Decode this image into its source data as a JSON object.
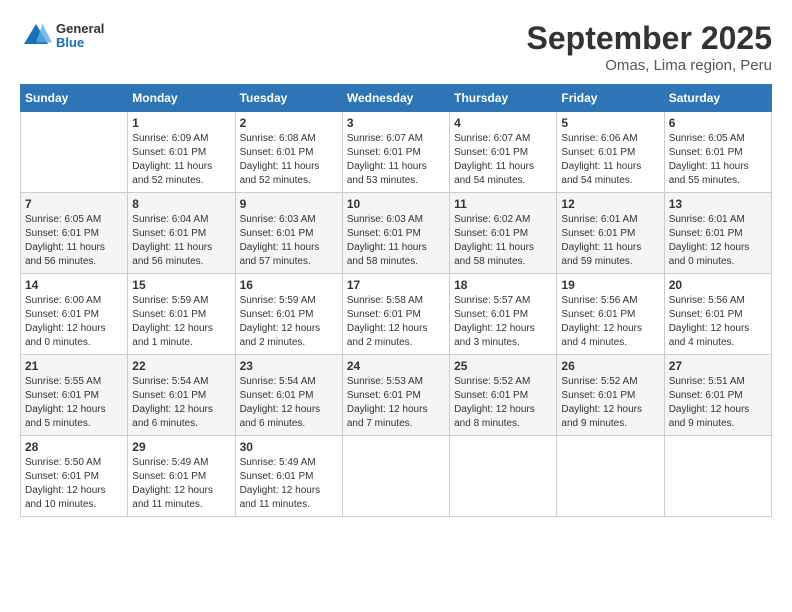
{
  "header": {
    "logo": {
      "general": "General",
      "blue": "Blue"
    },
    "title": "September 2025",
    "location": "Omas, Lima region, Peru"
  },
  "calendar": {
    "days_of_week": [
      "Sunday",
      "Monday",
      "Tuesday",
      "Wednesday",
      "Thursday",
      "Friday",
      "Saturday"
    ],
    "weeks": [
      [
        {
          "day": "",
          "sunrise": "",
          "sunset": "",
          "daylight": ""
        },
        {
          "day": "1",
          "sunrise": "Sunrise: 6:09 AM",
          "sunset": "Sunset: 6:01 PM",
          "daylight": "Daylight: 11 hours and 52 minutes."
        },
        {
          "day": "2",
          "sunrise": "Sunrise: 6:08 AM",
          "sunset": "Sunset: 6:01 PM",
          "daylight": "Daylight: 11 hours and 52 minutes."
        },
        {
          "day": "3",
          "sunrise": "Sunrise: 6:07 AM",
          "sunset": "Sunset: 6:01 PM",
          "daylight": "Daylight: 11 hours and 53 minutes."
        },
        {
          "day": "4",
          "sunrise": "Sunrise: 6:07 AM",
          "sunset": "Sunset: 6:01 PM",
          "daylight": "Daylight: 11 hours and 54 minutes."
        },
        {
          "day": "5",
          "sunrise": "Sunrise: 6:06 AM",
          "sunset": "Sunset: 6:01 PM",
          "daylight": "Daylight: 11 hours and 54 minutes."
        },
        {
          "day": "6",
          "sunrise": "Sunrise: 6:05 AM",
          "sunset": "Sunset: 6:01 PM",
          "daylight": "Daylight: 11 hours and 55 minutes."
        }
      ],
      [
        {
          "day": "7",
          "sunrise": "Sunrise: 6:05 AM",
          "sunset": "Sunset: 6:01 PM",
          "daylight": "Daylight: 11 hours and 56 minutes."
        },
        {
          "day": "8",
          "sunrise": "Sunrise: 6:04 AM",
          "sunset": "Sunset: 6:01 PM",
          "daylight": "Daylight: 11 hours and 56 minutes."
        },
        {
          "day": "9",
          "sunrise": "Sunrise: 6:03 AM",
          "sunset": "Sunset: 6:01 PM",
          "daylight": "Daylight: 11 hours and 57 minutes."
        },
        {
          "day": "10",
          "sunrise": "Sunrise: 6:03 AM",
          "sunset": "Sunset: 6:01 PM",
          "daylight": "Daylight: 11 hours and 58 minutes."
        },
        {
          "day": "11",
          "sunrise": "Sunrise: 6:02 AM",
          "sunset": "Sunset: 6:01 PM",
          "daylight": "Daylight: 11 hours and 58 minutes."
        },
        {
          "day": "12",
          "sunrise": "Sunrise: 6:01 AM",
          "sunset": "Sunset: 6:01 PM",
          "daylight": "Daylight: 11 hours and 59 minutes."
        },
        {
          "day": "13",
          "sunrise": "Sunrise: 6:01 AM",
          "sunset": "Sunset: 6:01 PM",
          "daylight": "Daylight: 12 hours and 0 minutes."
        }
      ],
      [
        {
          "day": "14",
          "sunrise": "Sunrise: 6:00 AM",
          "sunset": "Sunset: 6:01 PM",
          "daylight": "Daylight: 12 hours and 0 minutes."
        },
        {
          "day": "15",
          "sunrise": "Sunrise: 5:59 AM",
          "sunset": "Sunset: 6:01 PM",
          "daylight": "Daylight: 12 hours and 1 minute."
        },
        {
          "day": "16",
          "sunrise": "Sunrise: 5:59 AM",
          "sunset": "Sunset: 6:01 PM",
          "daylight": "Daylight: 12 hours and 2 minutes."
        },
        {
          "day": "17",
          "sunrise": "Sunrise: 5:58 AM",
          "sunset": "Sunset: 6:01 PM",
          "daylight": "Daylight: 12 hours and 2 minutes."
        },
        {
          "day": "18",
          "sunrise": "Sunrise: 5:57 AM",
          "sunset": "Sunset: 6:01 PM",
          "daylight": "Daylight: 12 hours and 3 minutes."
        },
        {
          "day": "19",
          "sunrise": "Sunrise: 5:56 AM",
          "sunset": "Sunset: 6:01 PM",
          "daylight": "Daylight: 12 hours and 4 minutes."
        },
        {
          "day": "20",
          "sunrise": "Sunrise: 5:56 AM",
          "sunset": "Sunset: 6:01 PM",
          "daylight": "Daylight: 12 hours and 4 minutes."
        }
      ],
      [
        {
          "day": "21",
          "sunrise": "Sunrise: 5:55 AM",
          "sunset": "Sunset: 6:01 PM",
          "daylight": "Daylight: 12 hours and 5 minutes."
        },
        {
          "day": "22",
          "sunrise": "Sunrise: 5:54 AM",
          "sunset": "Sunset: 6:01 PM",
          "daylight": "Daylight: 12 hours and 6 minutes."
        },
        {
          "day": "23",
          "sunrise": "Sunrise: 5:54 AM",
          "sunset": "Sunset: 6:01 PM",
          "daylight": "Daylight: 12 hours and 6 minutes."
        },
        {
          "day": "24",
          "sunrise": "Sunrise: 5:53 AM",
          "sunset": "Sunset: 6:01 PM",
          "daylight": "Daylight: 12 hours and 7 minutes."
        },
        {
          "day": "25",
          "sunrise": "Sunrise: 5:52 AM",
          "sunset": "Sunset: 6:01 PM",
          "daylight": "Daylight: 12 hours and 8 minutes."
        },
        {
          "day": "26",
          "sunrise": "Sunrise: 5:52 AM",
          "sunset": "Sunset: 6:01 PM",
          "daylight": "Daylight: 12 hours and 9 minutes."
        },
        {
          "day": "27",
          "sunrise": "Sunrise: 5:51 AM",
          "sunset": "Sunset: 6:01 PM",
          "daylight": "Daylight: 12 hours and 9 minutes."
        }
      ],
      [
        {
          "day": "28",
          "sunrise": "Sunrise: 5:50 AM",
          "sunset": "Sunset: 6:01 PM",
          "daylight": "Daylight: 12 hours and 10 minutes."
        },
        {
          "day": "29",
          "sunrise": "Sunrise: 5:49 AM",
          "sunset": "Sunset: 6:01 PM",
          "daylight": "Daylight: 12 hours and 11 minutes."
        },
        {
          "day": "30",
          "sunrise": "Sunrise: 5:49 AM",
          "sunset": "Sunset: 6:01 PM",
          "daylight": "Daylight: 12 hours and 11 minutes."
        },
        {
          "day": "",
          "sunrise": "",
          "sunset": "",
          "daylight": ""
        },
        {
          "day": "",
          "sunrise": "",
          "sunset": "",
          "daylight": ""
        },
        {
          "day": "",
          "sunrise": "",
          "sunset": "",
          "daylight": ""
        },
        {
          "day": "",
          "sunrise": "",
          "sunset": "",
          "daylight": ""
        }
      ]
    ]
  }
}
